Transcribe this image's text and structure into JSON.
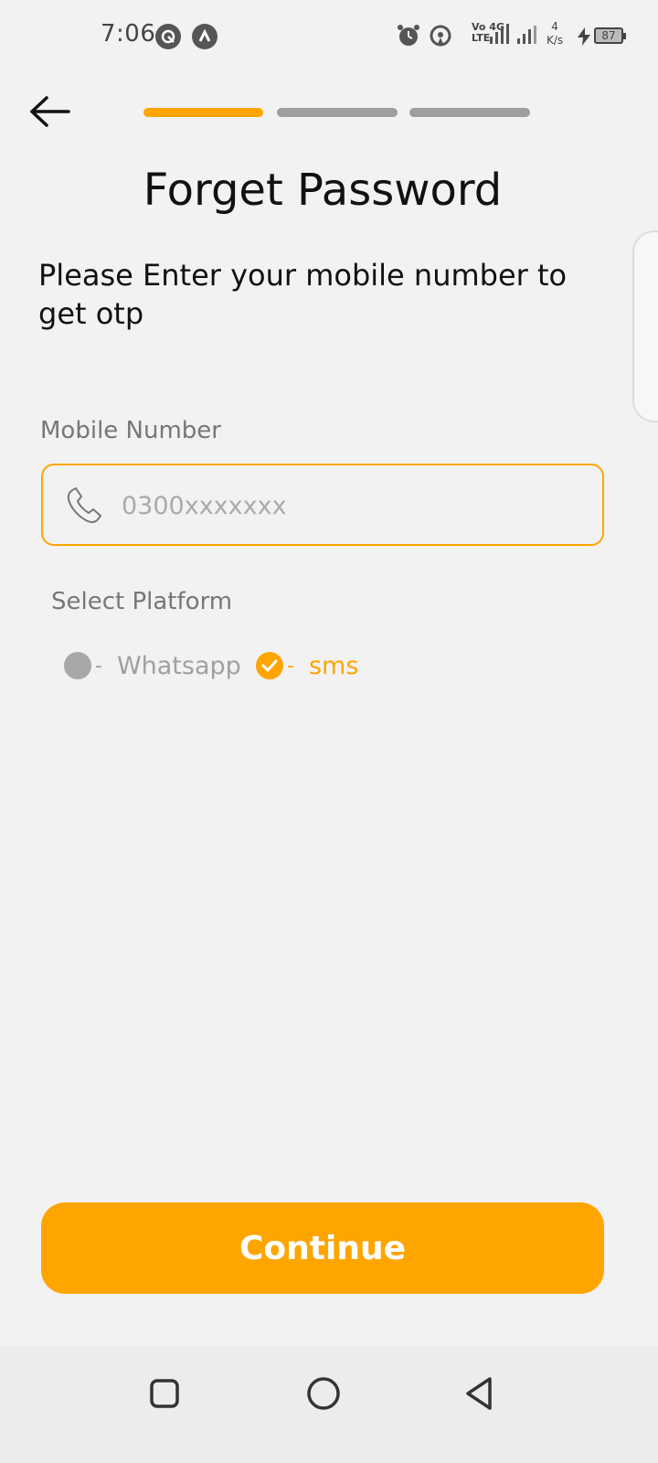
{
  "status_bar": {
    "time": "7:06",
    "network_top": "Vo 4G",
    "network_bottom": "LTE",
    "speed_value": "4",
    "speed_unit": "K/s",
    "battery": "87"
  },
  "header": {
    "back_icon": "arrow-left-icon",
    "steps_total": 3,
    "current_step": 1
  },
  "title": "Forget Password",
  "instructions": "Please Enter your mobile number to get otp",
  "mobile_field": {
    "label": "Mobile Number",
    "placeholder": "0300xxxxxxx",
    "value": "",
    "icon": "phone-icon"
  },
  "platform": {
    "label": "Select Platform",
    "separator": "-",
    "options": [
      {
        "label": "Whatsapp",
        "selected": false
      },
      {
        "label": "sms",
        "selected": true
      }
    ]
  },
  "continue_label": "Continue",
  "colors": {
    "accent": "#ffa500",
    "inactive": "#9e9e9e",
    "background": "#f2f2f2"
  }
}
